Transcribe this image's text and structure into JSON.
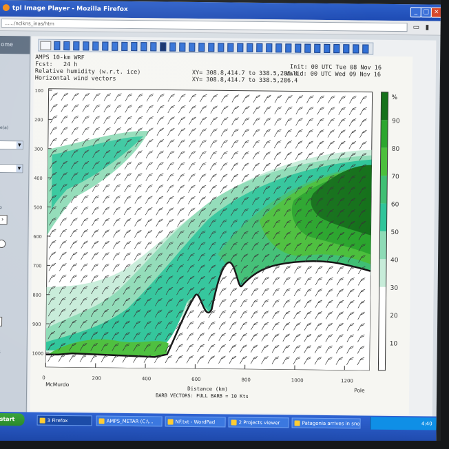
{
  "window": {
    "title": "tpl Image Player - Mozilla Firefox",
    "url": "....../nclkns_inas/htm",
    "buttons": [
      "_",
      "□",
      "×"
    ]
  },
  "left_panel": {
    "header": "ome",
    "labels": [
      "e(a)",
      "p",
      "B"
    ]
  },
  "frames": {
    "count": 33,
    "active_index": 11
  },
  "plot": {
    "header_left": [
      "AMPS 10-km WRF",
      "Fcst:   24 h",
      "Relative humidity (w.r.t. ice)",
      "Horizontal wind vectors"
    ],
    "header_mid": [
      "XY= 308.8,414.7 to 338.5,286.4",
      "XY= 308.8,414.7 to 338.5,286.4"
    ],
    "header_right": [
      "Init: 00 UTC Tue 08 Nov 16",
      "Valid: 00 UTC Wed 09 Nov 16"
    ],
    "y_ticks": [
      "100",
      "200",
      "300",
      "400",
      "500",
      "600",
      "700",
      "800",
      "900",
      "1000"
    ],
    "x_ticks": [
      "0",
      "200",
      "400",
      "600",
      "800",
      "1000",
      "1200"
    ],
    "x_end_labels": {
      "left": "McMurdo",
      "right": "Pole"
    },
    "x_label": "Distance (km)",
    "vector_label": "BARB VECTORS: FULL BARB = 10 Kts",
    "colorbar_unit": "%",
    "colorbar_ticks": [
      "10",
      "20",
      "30",
      "40",
      "50",
      "60",
      "70",
      "80",
      "90"
    ],
    "colors": {
      "rh_10": "#ffffff",
      "rh_30": "#c7ecd9",
      "rh_40": "#8edbb6",
      "rh_50": "#2fc59a",
      "rh_60": "#3fbf74",
      "rh_70": "#4bbf3c",
      "rh_80": "#2aa52d",
      "rh_90": "#14701a",
      "terrain": "#111111"
    }
  },
  "taskbar": {
    "start": "start",
    "tasks": [
      "3 Firefox",
      "AMPS_METAR (C:\\...",
      "NF.txt - WordPad",
      "2 Projects viewer",
      "Patagonia arrives in snow..."
    ],
    "clock": "4:40"
  }
}
